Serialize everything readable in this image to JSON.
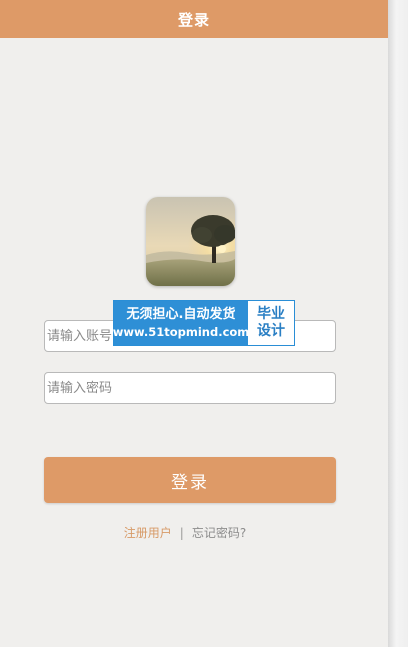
{
  "header": {
    "title": "登录"
  },
  "avatar": {
    "icon": "tree-sunset-avatar-icon"
  },
  "form": {
    "account_placeholder": "请输入账号",
    "password_placeholder": "请输入密码",
    "login_label": "登录"
  },
  "links": {
    "register": "注册用户",
    "separator": "|",
    "forgot": "忘记密码?"
  },
  "watermark": {
    "line1": "无须担心.自动发货",
    "line2": "www.51topmind.com",
    "right1": "毕业",
    "right2": "设计"
  },
  "colors": {
    "accent": "#de9a67",
    "background": "#f0efed",
    "watermark_blue": "#2e8fd6"
  }
}
